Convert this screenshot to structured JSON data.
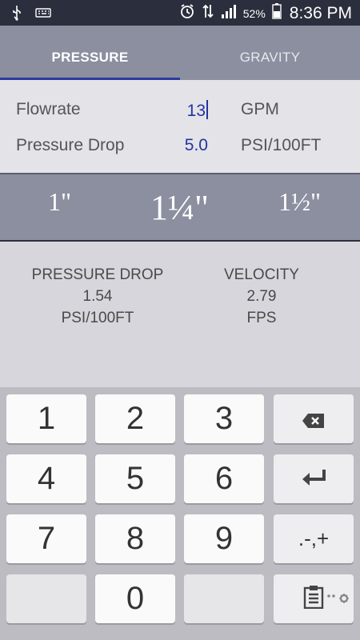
{
  "status": {
    "battery": "52%",
    "time": "8:36 PM"
  },
  "tabs": [
    {
      "label": "PRESSURE"
    },
    {
      "label": "GRAVITY"
    }
  ],
  "inputs": {
    "flowrate": {
      "label": "Flowrate",
      "value": "13",
      "unit": "GPM"
    },
    "pressure_drop": {
      "label": "Pressure Drop",
      "value": "5.0",
      "unit": "PSI/100FT"
    }
  },
  "sizes": [
    "1\"",
    "1¼\"",
    "1½\""
  ],
  "results": {
    "pressure": {
      "title": "PRESSURE DROP",
      "value": "1.54",
      "unit": "PSI/100FT"
    },
    "velocity": {
      "title": "VELOCITY",
      "value": "2.79",
      "unit": "FPS"
    }
  },
  "keypad": {
    "keys": [
      "1",
      "2",
      "3",
      "4",
      "5",
      "6",
      "7",
      "8",
      "9",
      "0"
    ],
    "symbols": ".-,+"
  },
  "colors": {
    "accent": "#2433a0",
    "header": "#8b8fa0",
    "statusbar": "#2b2f3d"
  }
}
